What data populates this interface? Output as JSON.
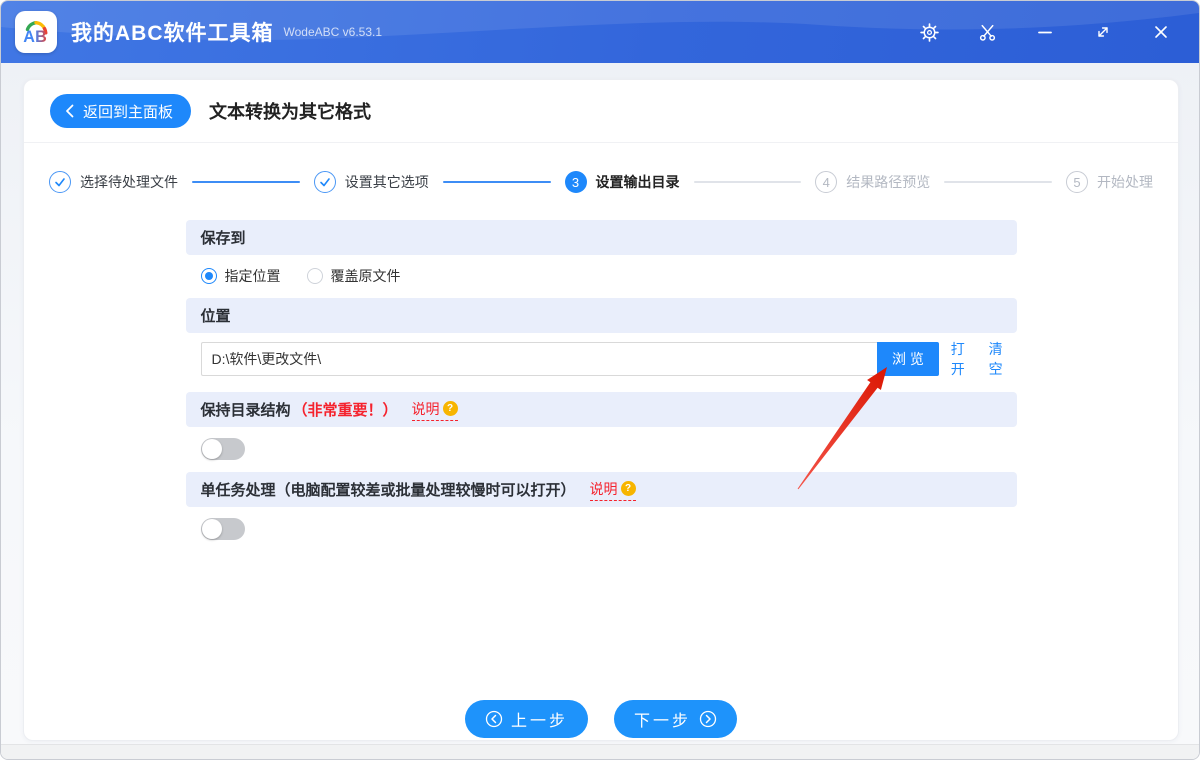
{
  "titlebar": {
    "app_title": "我的ABC软件工具箱",
    "version": "WodeABC v6.53.1",
    "logo_a": "A",
    "logo_b": "B"
  },
  "header": {
    "back_label": "返回到主面板",
    "page_title": "文本转换为其它格式"
  },
  "steps": [
    {
      "label": "选择待处理文件",
      "state": "done"
    },
    {
      "label": "设置其它选项",
      "state": "done"
    },
    {
      "number": "3",
      "label": "设置输出目录",
      "state": "current"
    },
    {
      "number": "4",
      "label": "结果路径预览",
      "state": "pending"
    },
    {
      "number": "5",
      "label": "开始处理",
      "state": "pending"
    }
  ],
  "form": {
    "save_to": {
      "header": "保存到",
      "option_specified": "指定位置",
      "option_overwrite": "覆盖原文件",
      "selected": "指定位置"
    },
    "location": {
      "header": "位置",
      "path_value": "D:\\软件\\更改文件\\",
      "browse_label": "浏 览",
      "open_label": "打开",
      "clear_label": "清空"
    },
    "keep_structure": {
      "title": "保持目录结构",
      "warning": "（非常重要！）",
      "help_label": "说明",
      "help_mark": "?",
      "enabled": false
    },
    "single_task": {
      "title": "单任务处理（电脑配置较差或批量处理较慢时可以打开）",
      "help_label": "说明",
      "help_mark": "?",
      "enabled": false
    }
  },
  "footer": {
    "prev_label": "上一步",
    "next_label": "下一步"
  },
  "colors": {
    "accent_blue": "#1e88fb",
    "titlebar_blue": "#3366db",
    "section_band_bg": "#e9eefb",
    "alert_red": "#f5222d",
    "help_orange": "#f7b500",
    "pending_gray": "#b3b8c2",
    "arrow_red": "#e8291c"
  }
}
